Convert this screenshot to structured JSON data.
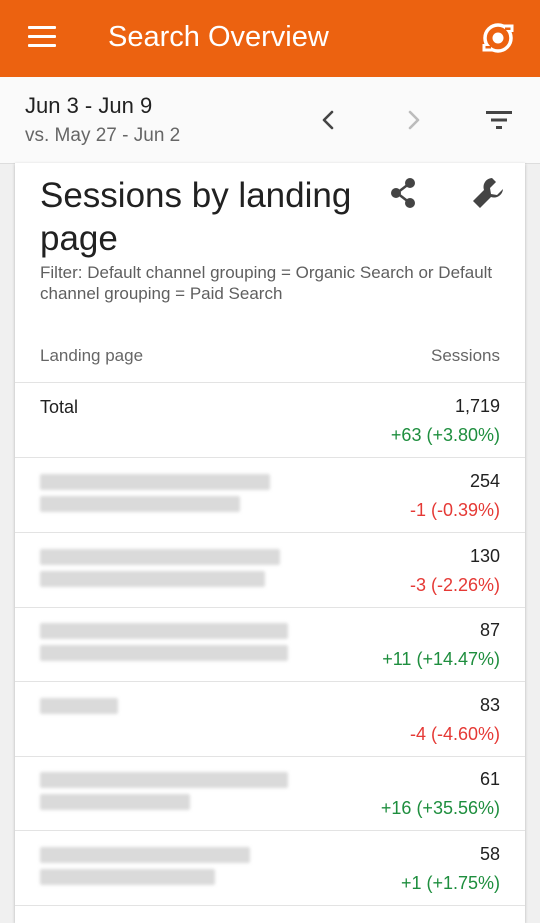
{
  "appbar": {
    "title": "Search Overview",
    "menu_icon": "menu-icon",
    "account_icon": "account-switch-icon",
    "color": "#ec6210"
  },
  "datebar": {
    "range": "Jun 3 - Jun 9",
    "compare": "vs. May 27 - Jun 2",
    "prev_icon": "chevron-left-icon",
    "next_icon": "chevron-right-icon",
    "filter_icon": "filter-icon"
  },
  "card": {
    "title": "Sessions by landing page",
    "filter": "Filter: Default channel grouping = Organic Search or Default channel grouping = Paid Search",
    "share_icon": "share-icon",
    "settings_icon": "wrench-icon",
    "columns": {
      "page": "Landing page",
      "sessions": "Sessions"
    },
    "total": {
      "label": "Total",
      "value": "1,719",
      "delta": "+63 (+3.80%)"
    },
    "rows": [
      {
        "value": "254",
        "delta": "-1 (-0.39%)",
        "trend": "down"
      },
      {
        "value": "130",
        "delta": "-3 (-2.26%)",
        "trend": "down"
      },
      {
        "value": "87",
        "delta": "+11 (+14.47%)",
        "trend": "up"
      },
      {
        "value": "83",
        "delta": "-4 (-4.60%)",
        "trend": "down"
      },
      {
        "value": "61",
        "delta": "+16 (+35.56%)",
        "trend": "up"
      },
      {
        "value": "58",
        "delta": "+1 (+1.75%)",
        "trend": "up"
      }
    ]
  },
  "colors": {
    "positive": "#1e8e3e",
    "negative": "#e53935"
  }
}
